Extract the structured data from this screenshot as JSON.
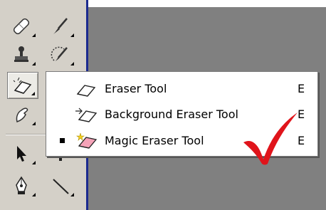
{
  "toolbox": {
    "tools": [
      {
        "icon": "healing-brush-icon"
      },
      {
        "icon": "brush-icon"
      },
      {
        "icon": "clone-stamp-icon"
      },
      {
        "icon": "history-brush-icon"
      },
      {
        "icon": "eraser-icon",
        "selected": true
      },
      {
        "icon": "smudge-icon"
      },
      {
        "icon": "path-selection-arrow-icon"
      },
      {
        "icon": "pen-icon"
      },
      {
        "icon": "line-icon"
      }
    ]
  },
  "flyout": {
    "items": [
      {
        "label": "Eraser Tool",
        "shortcut": "E",
        "icon": "eraser-icon",
        "active": false
      },
      {
        "label": "Background Eraser Tool",
        "shortcut": "E",
        "icon": "background-eraser-icon",
        "active": false
      },
      {
        "label": "Magic Eraser Tool",
        "shortcut": "E",
        "icon": "magic-eraser-icon",
        "active": true
      }
    ]
  },
  "annotation": {
    "icon": "red-checkmark-icon",
    "color": "#e0141b"
  },
  "colors": {
    "toolbox_bg": "#d4d0c8",
    "canvas_bg": "#808080",
    "divider_blue": "#1b2a8f"
  }
}
